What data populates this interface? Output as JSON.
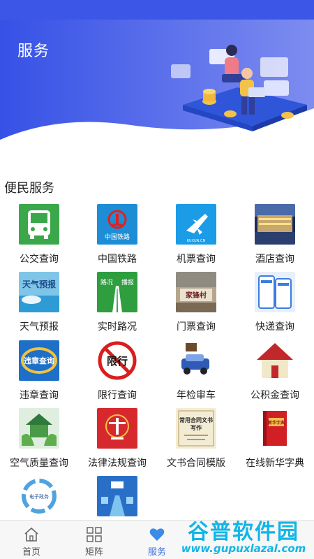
{
  "header": {
    "title": "服务"
  },
  "section": {
    "title": "便民服务"
  },
  "services": [
    {
      "label": "公交查询",
      "icon": "bus-icon"
    },
    {
      "label": "中国铁路",
      "icon": "china-railway-icon"
    },
    {
      "label": "机票查询",
      "icon": "airplane-icon"
    },
    {
      "label": "酒店查询",
      "icon": "hotel-icon"
    },
    {
      "label": "天气预报",
      "icon": "weather-icon"
    },
    {
      "label": "实时路况",
      "icon": "road-condition-icon"
    },
    {
      "label": "门票查询",
      "icon": "ticket-icon"
    },
    {
      "label": "快递查询",
      "icon": "express-icon"
    },
    {
      "label": "违章查询",
      "icon": "violation-icon"
    },
    {
      "label": "限行查询",
      "icon": "restriction-icon"
    },
    {
      "label": "年检审车",
      "icon": "inspection-icon"
    },
    {
      "label": "公积金查询",
      "icon": "housing-fund-icon"
    },
    {
      "label": "空气质量查询",
      "icon": "air-quality-icon"
    },
    {
      "label": "法律法规查询",
      "icon": "law-icon"
    },
    {
      "label": "文书合同模版",
      "icon": "contract-book-icon"
    },
    {
      "label": "在线新华字典",
      "icon": "dictionary-icon"
    },
    {
      "label": "",
      "icon": "e-government-icon"
    },
    {
      "label": "",
      "icon": "guide-icon"
    }
  ],
  "tile_texts": {
    "railway": "中国铁路",
    "airline": "KUXUN.CN",
    "weather": "天气预报",
    "road_left": "路况",
    "road_right": "播报",
    "ticket": "家锋村",
    "violation": "违章查询",
    "restriction": "限行",
    "contract_1": "常用合同文书",
    "contract_2": "写作",
    "dictionary": "新华字典",
    "egov": "电子政务"
  },
  "nav": {
    "home": "首页",
    "matrix": "矩阵",
    "service": "服务"
  },
  "watermark": {
    "main": "谷普软件园",
    "url": "www.gupuxlazal.com"
  },
  "colors": {
    "accent": "#3b6fe0",
    "banner": "#4a63ea"
  }
}
